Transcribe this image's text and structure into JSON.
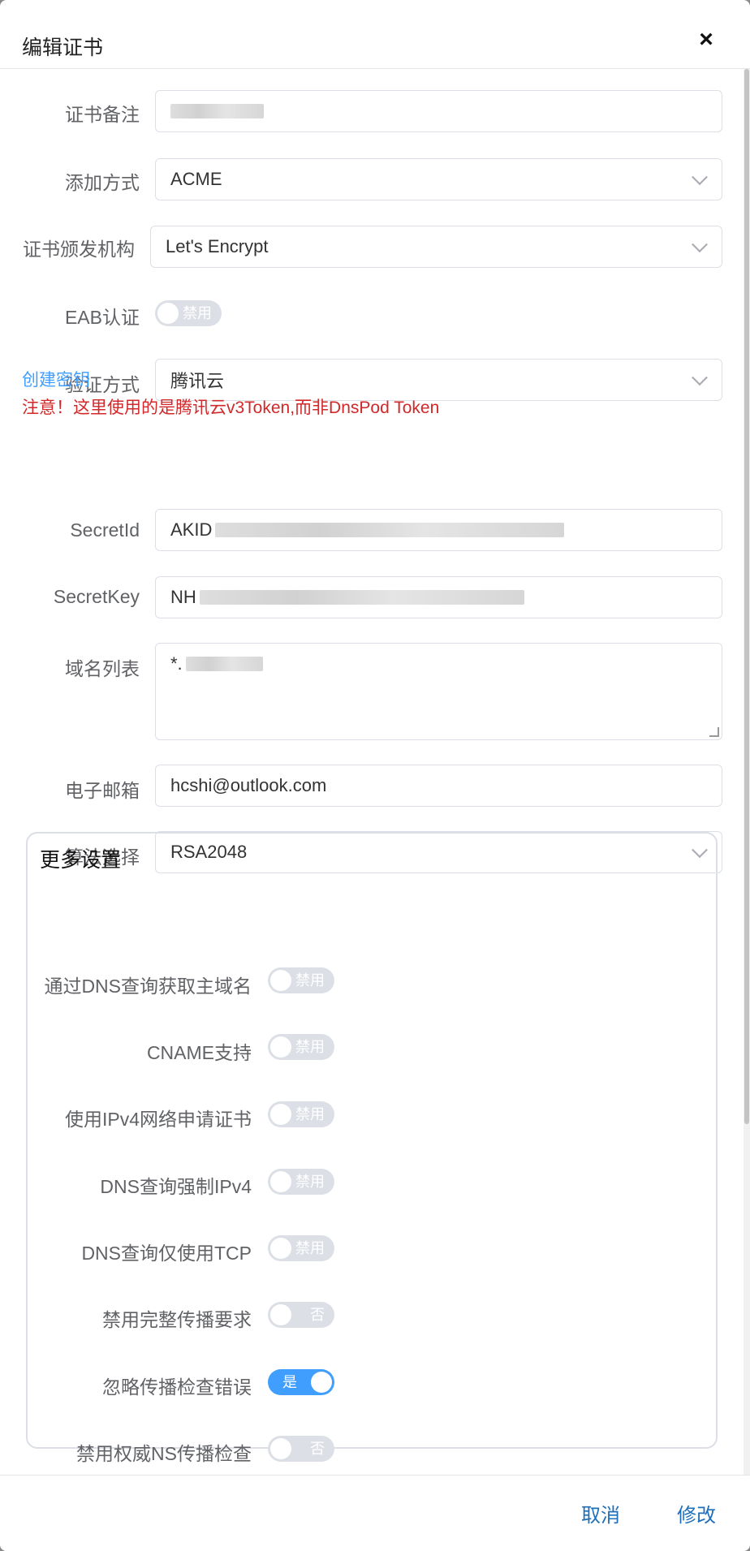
{
  "dialog": {
    "title": "编辑证书",
    "close_icon": "close-icon"
  },
  "form": {
    "remark": {
      "label": "证书备注",
      "value": ""
    },
    "method": {
      "label": "添加方式",
      "value": "ACME"
    },
    "ca": {
      "label": "证书颁发机构",
      "value": "Let's Encrypt"
    },
    "eab": {
      "label": "EAB认证",
      "state": "禁用"
    },
    "verify": {
      "label": "验证方式",
      "value": "腾讯云"
    },
    "create_key_link": "创建密钥",
    "warning": "注意！这里使用的是腾讯云v3Token,而非DnsPod Token",
    "secret_id": {
      "label": "SecretId",
      "value_visible": "AKID"
    },
    "secret_key": {
      "label": "SecretKey",
      "value_visible": "NH"
    },
    "domains": {
      "label": "域名列表",
      "value_visible": "*."
    },
    "email": {
      "label": "电子邮箱",
      "value": "hcshi@outlook.com"
    },
    "algo": {
      "label": "算法选择",
      "value": "RSA2048"
    }
  },
  "more": {
    "title": "更多设置",
    "items": [
      {
        "label": "通过DNS查询获取主域名",
        "state": "禁用",
        "on": false
      },
      {
        "label": "CNAME支持",
        "state": "禁用",
        "on": false
      },
      {
        "label": "使用IPv4网络申请证书",
        "state": "禁用",
        "on": false
      },
      {
        "label": "DNS查询强制IPv4",
        "state": "禁用",
        "on": false
      },
      {
        "label": "DNS查询仅使用TCP",
        "state": "禁用",
        "on": false
      },
      {
        "label": "禁用完整传播要求",
        "state": "否",
        "on": false
      },
      {
        "label": "忽略传播检查错误",
        "state": "是",
        "on": true
      },
      {
        "label": "禁用权威NS传播检查",
        "state": "否",
        "on": false
      }
    ]
  },
  "footer": {
    "cancel_label": "取消",
    "submit_label": "修改"
  },
  "colors": {
    "accent": "#409eff",
    "warning": "#d2282a",
    "switch_off": "#dcdfe6",
    "footer_button": "#1e6fb8"
  }
}
